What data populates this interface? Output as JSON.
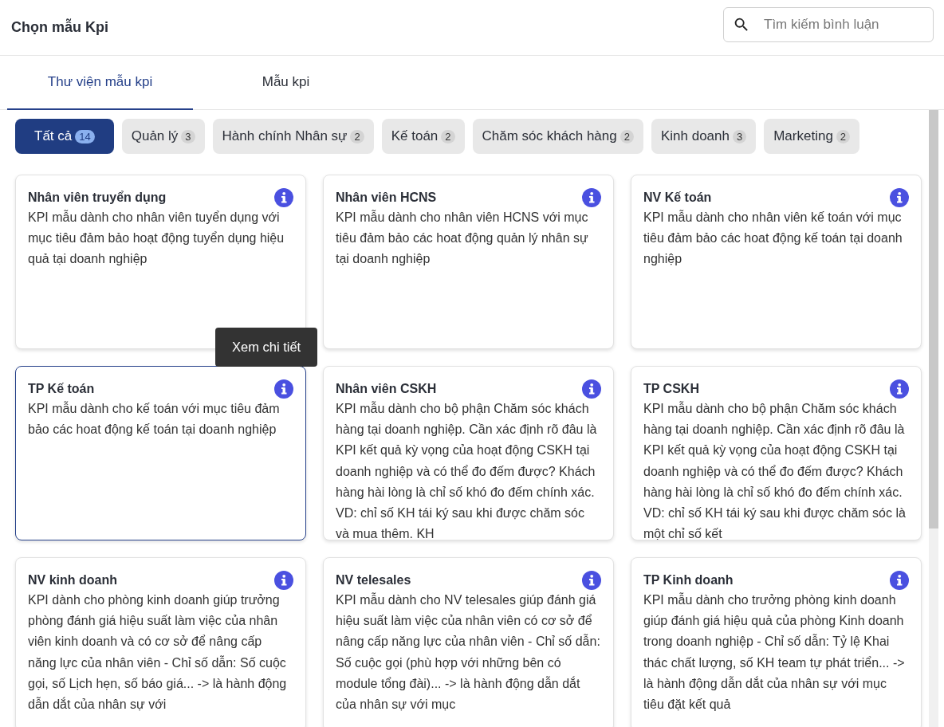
{
  "header": {
    "title": "Chọn mẫu Kpi",
    "search": {
      "placeholder": "Tìm kiếm bình luận"
    }
  },
  "tabs": [
    {
      "label": "Thư viện mẫu kpi",
      "selected": true
    },
    {
      "label": "Mẫu kpi",
      "selected": false
    }
  ],
  "filters": [
    {
      "label": "Tất cả",
      "count": "14",
      "selected": true
    },
    {
      "label": "Quản lý",
      "count": "3",
      "selected": false
    },
    {
      "label": "Hành chính Nhân sự",
      "count": "2",
      "selected": false
    },
    {
      "label": "Kế toán",
      "count": "2",
      "selected": false
    },
    {
      "label": "Chăm sóc khách hàng",
      "count": "2",
      "selected": false
    },
    {
      "label": "Kinh doanh",
      "count": "3",
      "selected": false
    },
    {
      "label": "Marketing",
      "count": "2",
      "selected": false
    }
  ],
  "cards": [
    {
      "title": "Nhân viên truyển dụng",
      "description": "KPI mẫu dành cho nhân viên tuyển dụng với mục tiêu đảm bảo hoạt động tuyển dụng hiệu quả tại doanh nghiệp",
      "selected": false
    },
    {
      "title": "Nhân viên HCNS",
      "description": "KPI mẫu dành cho nhân viên HCNS với mục tiêu đảm bảo các hoat động quản lý nhân sự tại doanh nghiệp",
      "selected": false
    },
    {
      "title": "NV Kế toán",
      "description": "KPI mẫu dành cho nhân viên kế toán với mục tiêu đảm bảo các hoat động kế toán tại doanh nghiệp",
      "selected": false
    },
    {
      "title": "TP Kế toán",
      "description": "KPI mẫu dành cho kế toán với mục tiêu đảm bảo các hoat động kế toán tại doanh nghiệp",
      "selected": true
    },
    {
      "title": "Nhân viên CSKH",
      "description": "KPI mẫu dành cho bộ phận Chăm sóc khách hàng tại doanh nghiệp. Cần xác định rõ đâu là KPI kết quả kỳ vọng của hoạt động CSKH tại doanh nghiệp và có thể đo đếm được? Khách hàng hài lòng là chỉ số khó đo đếm chính xác. VD: chỉ số KH tái ký sau khi được chăm sóc và mua thêm. KH",
      "selected": false
    },
    {
      "title": "TP CSKH",
      "description": "KPI mẫu dành cho bộ phận Chăm sóc khách hàng tại doanh nghiệp. Cần xác định rõ đâu là KPI kết quả kỳ vọng của hoạt động CSKH tại doanh nghiệp và có thể đo đếm được? Khách hàng hài lòng là chỉ số khó đo đếm chính xác. VD: chỉ số KH tái ký sau khi được chăm sóc là một chỉ số kết",
      "selected": false
    },
    {
      "title": "NV kinh doanh",
      "description": "KPI dành cho phòng kinh doanh giúp trưởng phòng đánh giá hiệu suất làm việc của nhân viên kinh doanh và có cơ sở để nâng cấp năng lực của nhân viên - Chỉ số dẫn: Số cuộc gọi, số Lịch hẹn, số báo giá... -> là hành động dẫn dắt của nhân sự với",
      "selected": false
    },
    {
      "title": "NV telesales",
      "description": "KPI mẫu dành cho NV telesales giúp đánh giá hiệu suất làm việc của nhân viên có cơ sở để nâng cấp năng lực của nhân viên - Chỉ số dẫn: Số cuộc gọi (phù hợp với những bên có module tổng đài)... -> là hành động dẫn dắt của nhân sự với mục",
      "selected": false
    },
    {
      "title": "TP Kinh doanh",
      "description": "KPI mẫu dành cho trưởng phòng kinh doanh giúp đánh giá hiệu quả của phòng Kinh doanh trong doanh nghiệp - Chỉ số dẫn: Tỷ lệ Khai thác chất lượng, số KH team tự phát triển... -> là hành động dẫn dắt của nhân sự với mục tiêu đặt kết quả",
      "selected": false
    }
  ],
  "tooltip": {
    "text": "Xem chi tiết"
  }
}
